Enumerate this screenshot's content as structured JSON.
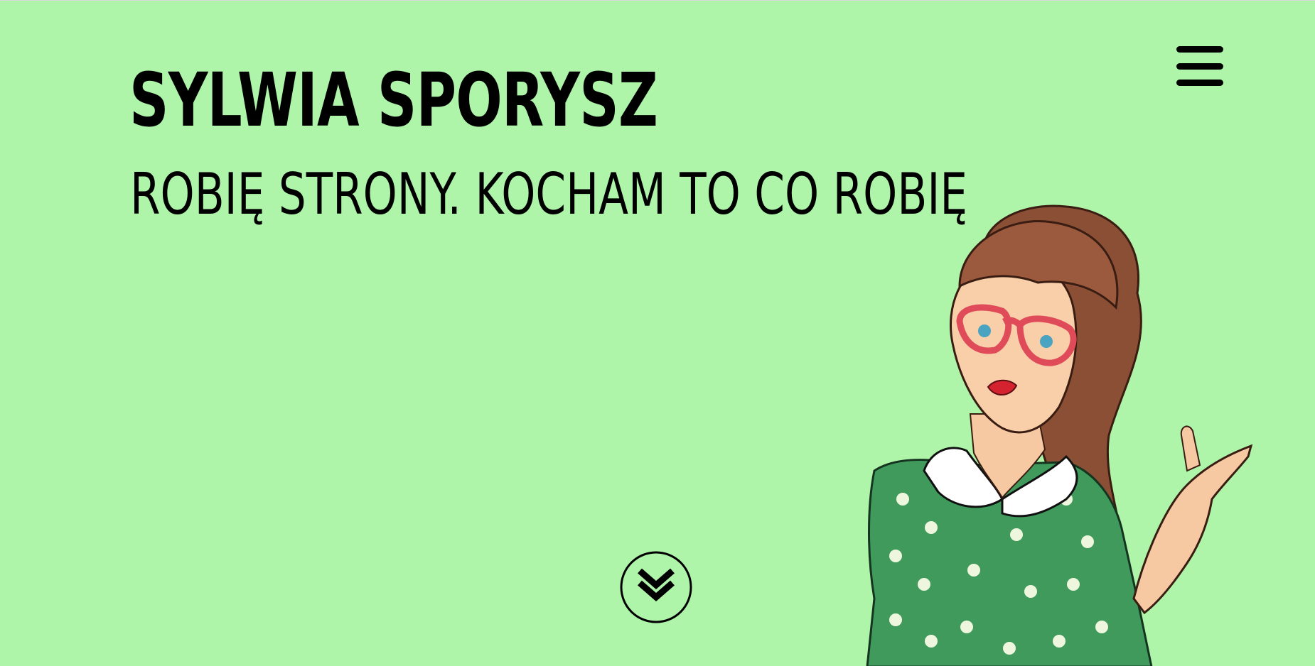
{
  "header": {
    "title": "SYLWIA SPORYSZ",
    "subtitle": "ROBIĘ STRONY. KOCHAM TO CO ROBIĘ"
  },
  "icons": {
    "menu": "hamburger-menu-icon",
    "scroll": "double-chevron-down-icon"
  },
  "colors": {
    "background": "#aef5aa",
    "text": "#000000",
    "dress": "#3f9a5c",
    "hair": "#8a4f35",
    "glasses": "#e04b5a"
  }
}
